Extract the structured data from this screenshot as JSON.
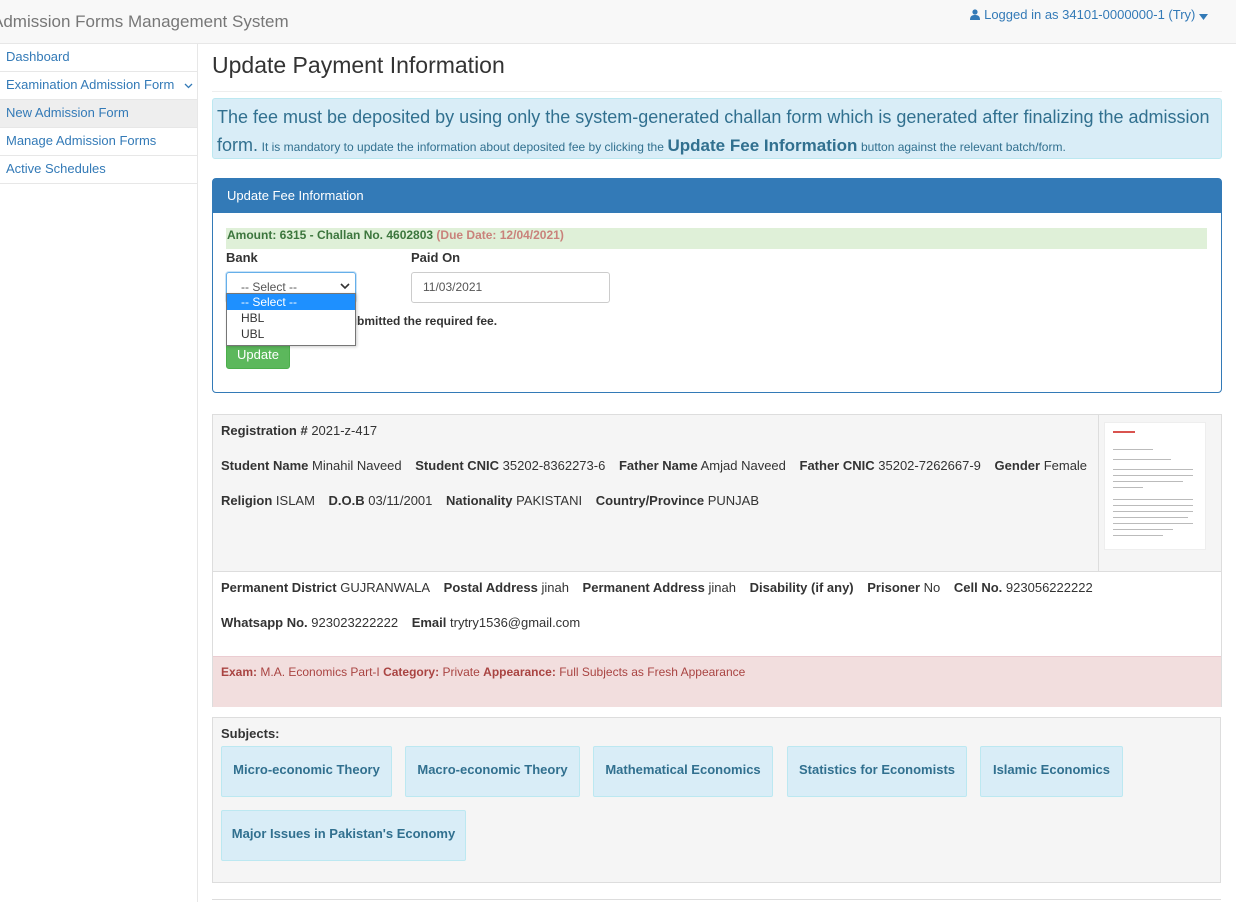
{
  "header": {
    "brand": "Admission Forms Management System",
    "user_label": "Logged in as 34101-0000000-1 (Try)"
  },
  "sidebar": {
    "items": [
      {
        "label": "Dashboard"
      },
      {
        "label": "Examination Admission Form"
      },
      {
        "label": "New Admission Form"
      },
      {
        "label": "Manage Admission Forms"
      },
      {
        "label": "Active Schedules"
      }
    ]
  },
  "page": {
    "title": "Update Payment Information",
    "alert_big": "The fee must be deposited by using only the system-generated challan form which is generated after finalizing the admission form.",
    "alert_small_1": "It is mandatory to update the information about deposited fee by clicking the",
    "alert_bold": "Update Fee Information",
    "alert_small_2": "button against the relevant batch/form."
  },
  "fee_panel": {
    "heading": "Update Fee Information",
    "amount_text": "Amount: 6315 - Challan No. 4602803",
    "due_text": "(Due Date: 12/04/2021)",
    "bank_label": "Bank",
    "paid_on_label": "Paid On",
    "bank_selected": "-- Select --",
    "bank_options": [
      "-- Select --",
      "HBL",
      "UBL"
    ],
    "paid_on_value": "11/03/2021",
    "confirm_text": "submitted the required fee.",
    "update_button": "Update"
  },
  "student": {
    "registration_label": "Registration #",
    "registration": "2021-z-417",
    "student_name_label": "Student Name",
    "student_name": "Minahil Naveed",
    "student_cnic_label": "Student CNIC",
    "student_cnic": "35202-8362273-6",
    "father_name_label": "Father Name",
    "father_name": "Amjad Naveed",
    "father_cnic_label": "Father CNIC",
    "father_cnic": "35202-7262667-9",
    "gender_label": "Gender",
    "gender": "Female",
    "religion_label": "Religion",
    "religion": "ISLAM",
    "dob_label": "D.O.B",
    "dob": "03/11/2001",
    "nationality_label": "Nationality",
    "nationality": "PAKISTANI",
    "country_label": "Country/Province",
    "country": "PUNJAB",
    "district_label": "Permanent District",
    "district": "GUJRANWALA",
    "postal_label": "Postal Address",
    "postal": "jinah",
    "permanent_label": "Permanent Address",
    "permanent": "jinah",
    "disability_label": "Disability (if any)",
    "prisoner_label": "Prisoner",
    "prisoner": "No",
    "cell_label": "Cell No.",
    "cell": "923056222222",
    "whatsapp_label": "Whatsapp No.",
    "whatsapp": "923023222222",
    "email_label": "Email",
    "email": "trytry1536@gmail.com"
  },
  "exam": {
    "exam_label": "Exam:",
    "exam": "M.A. Economics Part-I",
    "category_label": "Category:",
    "category": "Private",
    "appearance_label": "Appearance:",
    "appearance": "Full Subjects as Fresh Appearance"
  },
  "subjects": {
    "title": "Subjects:",
    "items": [
      "Micro-economic Theory",
      "Macro-economic Theory",
      "Mathematical Economics",
      "Statistics for Economists",
      "Islamic Economics",
      "Major Issues in Pakistan's Economy"
    ]
  },
  "colors": {
    "primary": "#337ab7",
    "success": "#5cb85c",
    "info_bg": "#d9edf7",
    "danger_bg": "#f2dede"
  }
}
